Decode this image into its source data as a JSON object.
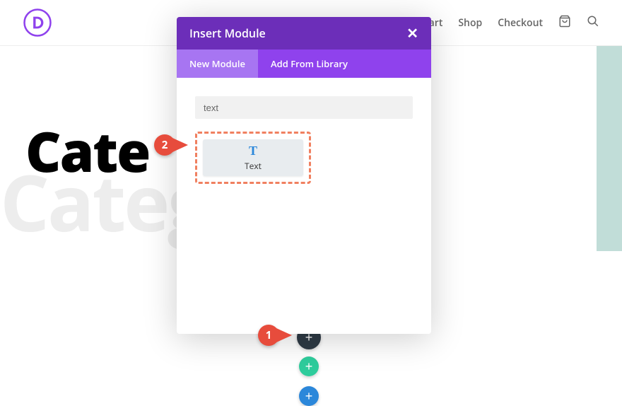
{
  "nav": {
    "link_cart_partial": "art",
    "link_shop": "Shop",
    "link_checkout": "Checkout"
  },
  "background": {
    "title_visible": "Cate",
    "title_ghost": "Categ"
  },
  "modal": {
    "title": "Insert Module",
    "tabs": {
      "new": "New Module",
      "library": "Add From Library"
    },
    "search_value": "text",
    "module": {
      "icon": "T",
      "label": "Text"
    }
  },
  "add_buttons": {
    "plus": "+"
  },
  "callouts": {
    "one": "1",
    "two": "2"
  }
}
